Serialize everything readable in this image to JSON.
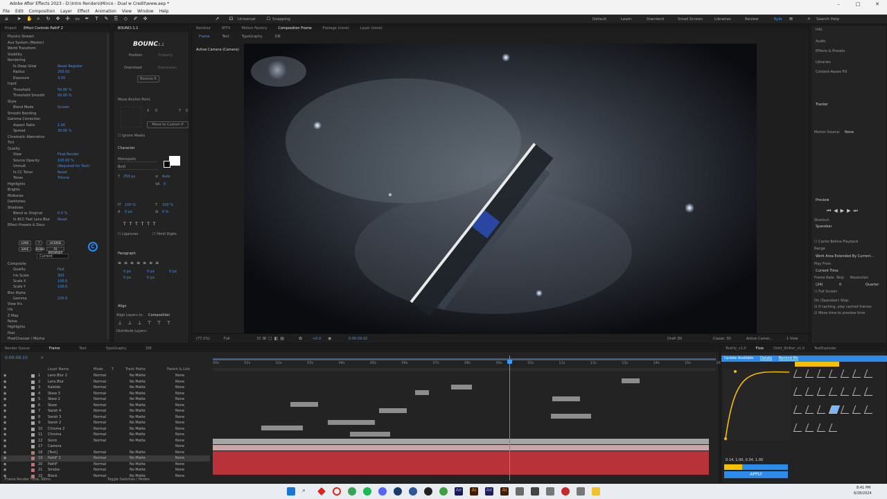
{
  "app": {
    "title": "Adobe After Effects 2023 - D:\\Intro Renders\\Minco - Dual w Credit\\www.aep *",
    "window_controls": [
      "–",
      "□",
      "✕"
    ],
    "menu": [
      "File",
      "Edit",
      "Composition",
      "Layer",
      "Effect",
      "Animation",
      "View",
      "Window",
      "Help"
    ]
  },
  "workspaces": [
    "Default",
    "Learn",
    "Standard",
    "Small Screen",
    "Libraries",
    "Review",
    "Kyle"
  ],
  "search_help": "Search Help",
  "toolbar": {
    "universal": "Universal",
    "snapping": "Snapping"
  },
  "effect_controls": {
    "tabs": [
      "Project",
      "Effect Controls PathF 2",
      "BOUNCI-1.1"
    ],
    "rows": [
      {
        "label": "Physics Stream",
        "value": ""
      },
      {
        "label": "Aux System (Master)",
        "value": ""
      },
      {
        "label": "World Transform",
        "value": ""
      },
      {
        "label": "Visibility",
        "value": ""
      },
      {
        "label": "Rendering",
        "value": ""
      },
      {
        "label": "fx Deep Glow",
        "value": "Reset  Register"
      },
      {
        "label": "Radius",
        "value": "250.00"
      },
      {
        "label": "Exposure",
        "value": "3.00"
      },
      {
        "label": "Input",
        "value": ""
      },
      {
        "label": "Threshold",
        "value": "50.00 %"
      },
      {
        "label": "Threshold Smooth",
        "value": "50.00 %"
      },
      {
        "label": "Style",
        "value": ""
      },
      {
        "label": "Blend Mode",
        "value": "Screen"
      },
      {
        "label": "Smooth Banding",
        "value": ""
      },
      {
        "label": "Gamma Correction",
        "value": ""
      },
      {
        "label": "Aspect Ratio",
        "value": "1.00"
      },
      {
        "label": "Spread",
        "value": "30.00 %"
      },
      {
        "label": "Chromatic Aberration",
        "value": ""
      },
      {
        "label": "Tint",
        "value": ""
      },
      {
        "label": "Quality",
        "value": ""
      },
      {
        "label": "View",
        "value": "Final Render"
      },
      {
        "label": "Source Opacity",
        "value": "100.00 %"
      },
      {
        "label": "Unmult",
        "value": "(Required for Text)"
      },
      {
        "label": "fx CC Toner",
        "value": "Reset"
      },
      {
        "label": "Tones",
        "value": "Tritone"
      },
      {
        "label": "Highlights",
        "value": ""
      },
      {
        "label": "Brights",
        "value": ""
      },
      {
        "label": "Midtones",
        "value": ""
      },
      {
        "label": "Darktones",
        "value": ""
      },
      {
        "label": "Shadows",
        "value": ""
      },
      {
        "label": "Blend w. Original",
        "value": "0.0 %"
      },
      {
        "label": "fx BCC Fast Lens Blur",
        "value": "Reset"
      },
      {
        "label": "Effect Presets & Docs",
        "value": ""
      }
    ],
    "bcc_buttons": [
      "LOAD",
      "?",
      "LICENSE",
      "SAVE",
      "BUILD",
      "FX BROWSER"
    ],
    "current": "Current",
    "rows2": [
      {
        "label": "Composite",
        "value": ""
      },
      {
        "label": "Quality",
        "value": "Fast"
      },
      {
        "label": "Iris Scale",
        "value": "300"
      },
      {
        "label": "Scale X",
        "value": "100.0"
      },
      {
        "label": "Scale Y",
        "value": "100.0"
      },
      {
        "label": "Blur Alpha",
        "value": ""
      },
      {
        "label": "Gamma",
        "value": "220.0"
      },
      {
        "label": "View Iris",
        "value": ""
      },
      {
        "label": "Iris",
        "value": ""
      },
      {
        "label": "Z Map",
        "value": ""
      },
      {
        "label": "Noise",
        "value": ""
      },
      {
        "label": "Highlights",
        "value": ""
      },
      {
        "label": "Post",
        "value": ""
      },
      {
        "label": "PixelChooser / Mocha",
        "value": ""
      }
    ]
  },
  "bounce_panel": {
    "logo": "BOUNC",
    "logo_suffix": "1.1",
    "tabs": [
      "Position",
      "Property"
    ],
    "overshoot": "Overshoot",
    "expression": "Expression",
    "bounce_it": "Bounce It",
    "move_anchor": "Move Anchor Point",
    "move_to_custom": "Move to Custom P",
    "ignore_masks": "Ignore Masks",
    "x_label": "X",
    "y_label": "Y",
    "x_val": "0",
    "y_val": "0"
  },
  "character": {
    "title": "Character",
    "font": "Metropolis",
    "style": "Bold",
    "size": "250 px",
    "leading": "Auto",
    "tracking": "0",
    "scale_v": "100 %",
    "scale_h": "100 %",
    "baseline": "0 px",
    "tsume": "0 %",
    "ligatures": "Ligatures",
    "hindi_digits": "Hindi Digits"
  },
  "paragraph": {
    "title": "Paragraph",
    "vals": [
      "0 px",
      "0 px",
      "0 px",
      "0 px",
      "0 px"
    ]
  },
  "align": {
    "title": "Align",
    "align_layers_to": "Align Layers to:",
    "target": "Composition",
    "distribute": "Distribute Layers:"
  },
  "viewer": {
    "tabs": [
      "Ramblur",
      "RTFX",
      "Motion Factory",
      "Composition Frame",
      "Footage (none)",
      "Layer (none)"
    ],
    "subtabs": [
      "Frame",
      "Text",
      "TypoGraphy",
      "DIE"
    ],
    "camera_label": "Active Camera (Camera)",
    "zoom": "(77.1%)",
    "resolution": "Full",
    "timecode": "0:00:09:10",
    "exposure": "+0.0",
    "renderer_label": "Draft 3D",
    "renderer": "Classic 3D",
    "camera": "Active Camer...",
    "views": "1 View"
  },
  "right_panel": {
    "items": [
      "Info",
      "Audio",
      "Effects & Presets",
      "Align",
      "Libraries",
      "Content-Aware Fill"
    ],
    "tracker": "Tracker",
    "motion_source": "Motion Source:",
    "motion_source_val": "None",
    "preview": "Preview",
    "shortcut": "Shortcut",
    "shortcut_val": "Spacebar",
    "cache_before": "Cache Before Playback",
    "range": "Range",
    "range_val": "Work Area Extended By Current...",
    "play_from": "Play From",
    "play_from_val": "Current Time",
    "frame_rate": "Frame Rate",
    "frame_rate_val": "(24)",
    "skip": "Skip",
    "skip_val": "0",
    "resolution": "Resolution",
    "resolution_val": "Quarter",
    "full_screen": "Full Screen",
    "on_stop": "On (Spacebar) Stop:",
    "if_caching": "If caching, play cached frames",
    "move_time": "Move time to preview time"
  },
  "timeline": {
    "tabs": [
      "Render Queue",
      "Frame",
      "Text",
      "TypoGraphy",
      "DIE"
    ],
    "timecode": "0:00:09:10",
    "columns": [
      "Layer Name",
      "Mode",
      "T",
      "Track Matte",
      "Parent & Link"
    ],
    "layers": [
      {
        "num": "1",
        "name": "Lens Blur 2",
        "mode": "Normal",
        "matte": "No Matte",
        "parent": "None"
      },
      {
        "num": "2",
        "name": "Lens Blur",
        "mode": "Normal",
        "matte": "No Matte",
        "parent": "None"
      },
      {
        "num": "3",
        "name": "Kaleido",
        "mode": "Normal",
        "matte": "No Matte",
        "parent": "None"
      },
      {
        "num": "4",
        "name": "Skew 3",
        "mode": "Normal",
        "matte": "No Matte",
        "parent": "None"
      },
      {
        "num": "5",
        "name": "Skew 2",
        "mode": "Normal",
        "matte": "No Matte",
        "parent": "None"
      },
      {
        "num": "6",
        "name": "Skew",
        "mode": "Normal",
        "matte": "No Matte",
        "parent": "None"
      },
      {
        "num": "7",
        "name": "Swish 4",
        "mode": "Normal",
        "matte": "No Matte",
        "parent": "None"
      },
      {
        "num": "8",
        "name": "Swish 3",
        "mode": "Normal",
        "matte": "No Matte",
        "parent": "None"
      },
      {
        "num": "9",
        "name": "Swish 2",
        "mode": "Normal",
        "matte": "No Matte",
        "parent": "None"
      },
      {
        "num": "10",
        "name": "Chroma 2",
        "mode": "Normal",
        "matte": "No Matte",
        "parent": "None"
      },
      {
        "num": "11",
        "name": "Chroma",
        "mode": "Normal",
        "matte": "No Matte",
        "parent": "None"
      },
      {
        "num": "12",
        "name": "Sonic",
        "mode": "Normal",
        "matte": "No Matte",
        "parent": "None"
      },
      {
        "num": "17",
        "name": "Camera",
        "mode": "",
        "matte": "",
        "parent": "None"
      },
      {
        "num": "18",
        "name": "[Text]",
        "mode": "Normal",
        "matte": "No Matte",
        "parent": "None"
      },
      {
        "num": "19",
        "name": "PathF 2",
        "mode": "Normal",
        "matte": "No Matte",
        "parent": "None"
      },
      {
        "num": "20",
        "name": "PathF",
        "mode": "Normal",
        "matte": "No Matte",
        "parent": "None"
      },
      {
        "num": "21",
        "name": "Smoke",
        "mode": "Normal",
        "matte": "No Matte",
        "parent": "None"
      },
      {
        "num": "22",
        "name": "Black",
        "mode": "Normal",
        "matte": "No Matte",
        "parent": "None"
      }
    ],
    "ruler": [
      "00s",
      "01s",
      "02s",
      "03s",
      "04s",
      "05s",
      "06s",
      "07s",
      "08s",
      "09s",
      "10s",
      "11s",
      "12s",
      "13s",
      "14s",
      "15s",
      "16s"
    ],
    "footer_left": "Frame Render Time: 99ms",
    "footer_mid": "Toggle Switches / Modes"
  },
  "flow": {
    "tabs": [
      "Textify_v1.0",
      "Flow",
      "Orbit_Shifter_v1.0",
      "TextExploder"
    ],
    "update": "Update Available",
    "details": "Details",
    "remind": "Remind Me",
    "bezier": "0.14, 1.00, 0.34, 1.00",
    "apply": "APPLY"
  },
  "taskbar": {
    "time": "8:41 PM",
    "date": "6/28/2024"
  },
  "colors": {
    "accent": "#2d8ceb",
    "timeline_red": "#b8323a",
    "bar_gray": "#8d8d8d",
    "flow_yellow": "#f6c000"
  }
}
